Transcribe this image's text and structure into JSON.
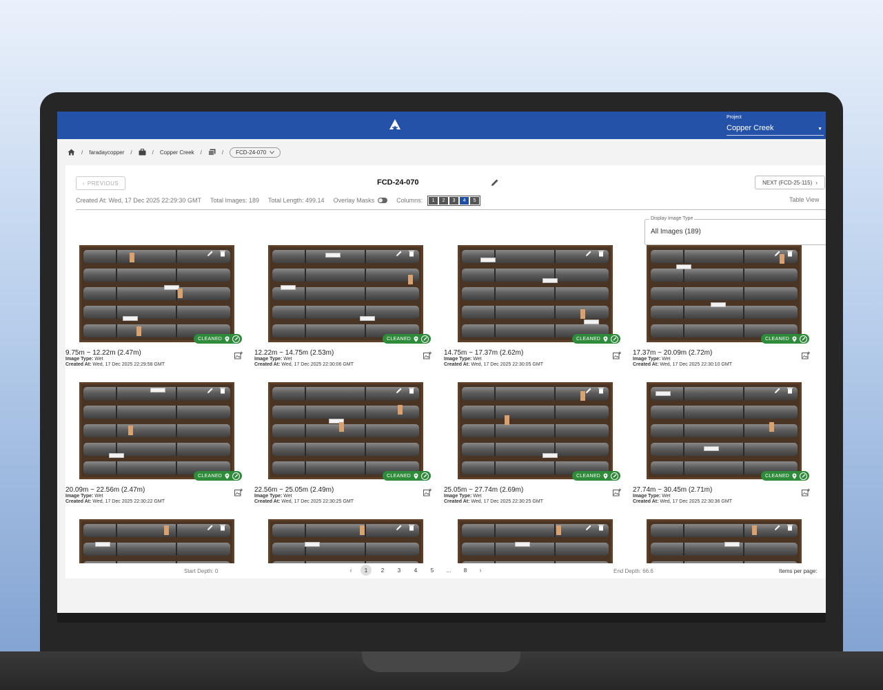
{
  "header": {
    "project_label": "Project",
    "project_value": "Copper Creek"
  },
  "breadcrumb": {
    "org": "faradaycopper",
    "project": "Copper Creek",
    "hole": "FCD-24-070"
  },
  "toolbar": {
    "previous_label": "PREVIOUS",
    "next_label": "NEXT (FCD-25-115)",
    "title": "FCD-24-070",
    "created_at": "Created At: Wed, 17 Dec 2025 22:29:30 GMT",
    "total_images": "Total Images: 189",
    "total_length": "Total Length: 499.14",
    "overlay_masks_label": "Overlay Masks",
    "columns_label": "Columns:",
    "column_options": [
      "1",
      "2",
      "3",
      "4",
      "5"
    ],
    "active_columns": "4",
    "table_view_label": "Table View"
  },
  "display_type": {
    "label": "Display Image Type",
    "value": "All Images (189)"
  },
  "image_type_label": "Image Type:",
  "created_at_label": "Created At:",
  "cards": [
    {
      "depth": "9.75m ~ 12.22m (2.47m)",
      "image_type": "Wet",
      "created_at": "Wed, 17 Dec 2025 22:29:58 GMT",
      "badge": "CLEANED"
    },
    {
      "depth": "12.22m ~ 14.75m (2.53m)",
      "image_type": "Wet",
      "created_at": "Wed, 17 Dec 2025 22:30:06 GMT",
      "badge": "CLEANED"
    },
    {
      "depth": "14.75m ~ 17.37m (2.62m)",
      "image_type": "Wet",
      "created_at": "Wed, 17 Dec 2025 22:30:05 GMT",
      "badge": "CLEANED"
    },
    {
      "depth": "17.37m ~ 20.09m (2.72m)",
      "image_type": "Wet",
      "created_at": "Wed, 17 Dec 2025 22:30:10 GMT",
      "badge": "CLEANED"
    },
    {
      "depth": "20.09m ~ 22.56m (2.47m)",
      "image_type": "Wet",
      "created_at": "Wed, 17 Dec 2025 22:30:22 GMT",
      "badge": "CLEANED"
    },
    {
      "depth": "22.56m ~ 25.05m (2.49m)",
      "image_type": "Wet",
      "created_at": "Wed, 17 Dec 2025 22:30:25 GMT",
      "badge": "CLEANED"
    },
    {
      "depth": "25.05m ~ 27.74m (2.69m)",
      "image_type": "Wet",
      "created_at": "Wed, 17 Dec 2025 22:30:25 GMT",
      "badge": "CLEANED"
    },
    {
      "depth": "27.74m ~ 30.45m (2.71m)",
      "image_type": "Wet",
      "created_at": "Wed, 17 Dec 2025 22:30:36 GMT",
      "badge": "CLEANED"
    }
  ],
  "footer": {
    "start_depth": "Start Depth: 0",
    "end_depth": "End Depth: 66.6",
    "items_per_page": "Items per page:",
    "pages": [
      "1",
      "2",
      "3",
      "4",
      "5",
      "...",
      "8"
    ],
    "active_page": "1"
  },
  "colors": {
    "header_blue": "#2452a8",
    "badge_green": "#2e8b3a",
    "active_column": "#1f4ea3"
  }
}
